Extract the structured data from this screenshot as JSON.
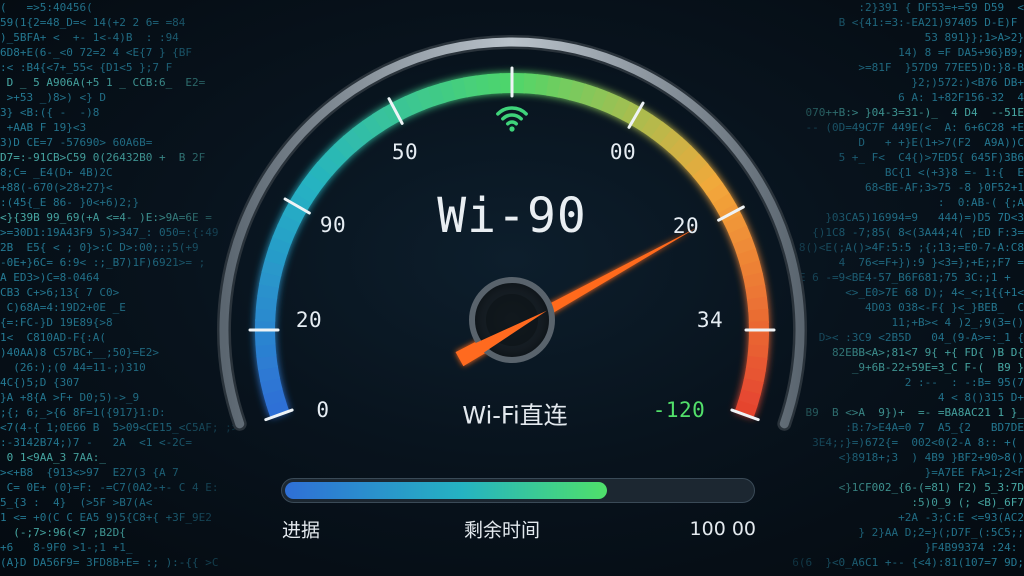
{
  "gauge": {
    "title": "Wi-90",
    "subtitle": "Wi-Fi直连",
    "wifi_icon": "wifi-icon",
    "needle_color": "#ff6a1f",
    "scale_labels": [
      {
        "text": "0",
        "color": "#e6edf3"
      },
      {
        "text": "20",
        "color": "#e6edf3"
      },
      {
        "text": "90",
        "color": "#e6edf3"
      },
      {
        "text": "50",
        "color": "#e6edf3"
      },
      {
        "text": "00",
        "color": "#e6edf3"
      },
      {
        "text": "20",
        "color": "#e6edf3"
      },
      {
        "text": "34",
        "color": "#e6edf3"
      },
      {
        "text": "-120",
        "color": "#52e06a"
      }
    ],
    "arc_colors": [
      "#2f6fd6",
      "#25b3c2",
      "#4fd66a",
      "#f2a83a",
      "#e5452f"
    ]
  },
  "progress": {
    "fraction": 0.69,
    "left_label": "进据",
    "center_label": "剩余时间",
    "right_label": "100 00"
  }
}
